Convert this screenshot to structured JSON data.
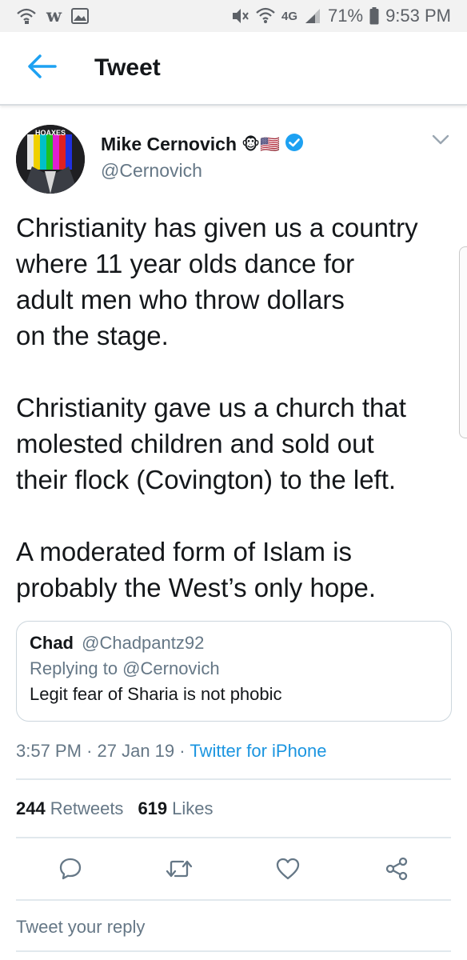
{
  "status_bar": {
    "left_icons": [
      "wifi-calling-icon",
      "w-app-icon",
      "image-icon"
    ],
    "w_glyph": "w",
    "network": "4G",
    "battery": "71%",
    "time": "9:53 PM"
  },
  "header": {
    "title": "Tweet"
  },
  "tweet": {
    "author_name": "Mike Cernovich",
    "author_emoji": "🐵🇺🇸",
    "author_handle": "@Cernovich",
    "avatar_text": "HOAXES",
    "lines_p1": [
      "Christianity has given us a country",
      "where 11 year olds dance for",
      "adult men who throw dollars",
      "on the stage."
    ],
    "lines_p2": [
      "Christianity gave us a church that",
      "molested children and sold out",
      "their flock (Covington) to the left."
    ],
    "lines_p3": [
      "A moderated form of Islam is",
      "probably the West’s only hope."
    ]
  },
  "quote": {
    "name": "Chad",
    "handle": "@Chadpantz92",
    "reply_to": "Replying to @Cernovich",
    "text": "Legit fear of Sharia is not phobic"
  },
  "meta": {
    "time": "3:57 PM",
    "date": "27 Jan 19",
    "source": "Twitter for iPhone",
    "sep": "·"
  },
  "stats": {
    "retweets_count": "244",
    "retweets_label": "Retweets",
    "likes_count": "619",
    "likes_label": "Likes"
  },
  "reply_placeholder": "Tweet your reply",
  "colors": {
    "accent": "#1da1f2",
    "link": "#1b95e0",
    "secondary_text": "#657786",
    "verified": "#1da1f2"
  }
}
